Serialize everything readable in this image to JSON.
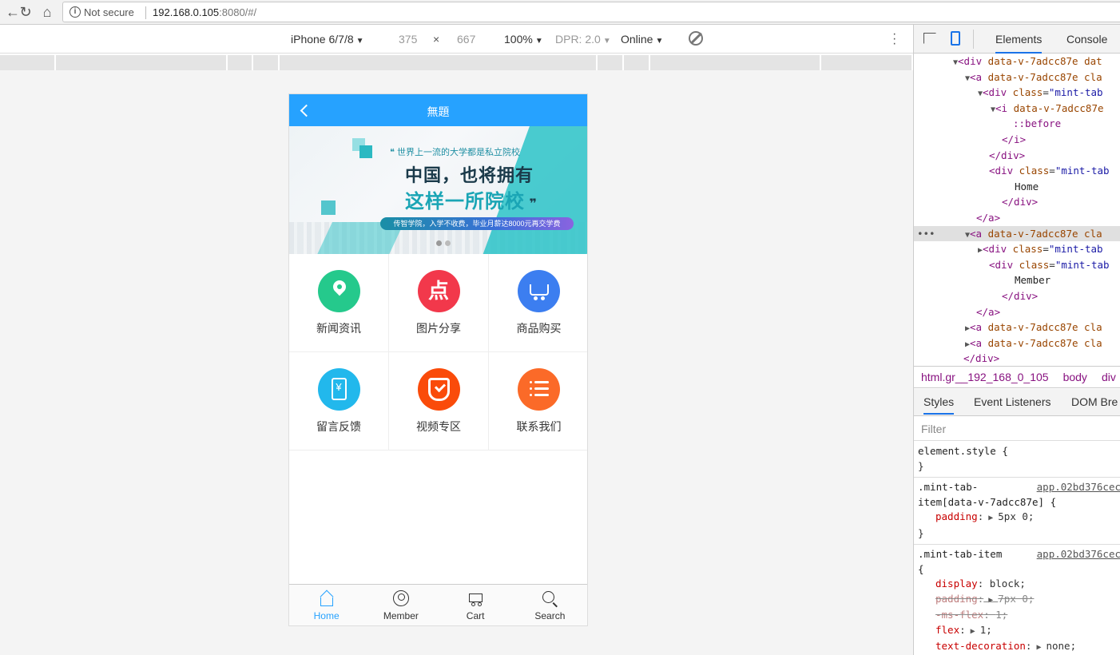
{
  "browser": {
    "security_label": "Not secure",
    "url_host": "192.168.0.105",
    "url_rest": ":8080/#/"
  },
  "device_toolbar": {
    "device": "iPhone 6/7/8",
    "width": "375",
    "times": "×",
    "height": "667",
    "zoom": "100%",
    "dpr": "DPR: 2.0",
    "network": "Online"
  },
  "app": {
    "header_title": "無題",
    "banner": {
      "quote": "❝ 世界上一流的大学都是私立院校",
      "line1": "中国，也将拥有",
      "line2_a": "这样一所院校",
      "line2_b": " ❞",
      "pill": "传智学院，入学不收费，毕业月薪达8000元再交学费"
    },
    "grid": [
      {
        "label": "新闻资讯",
        "icon": "location-pin-icon",
        "color": "#25c98c"
      },
      {
        "label": "图片分享",
        "icon": "dian-icon",
        "color": "#f2384b"
      },
      {
        "label": "商品购买",
        "icon": "shopping-cart-icon",
        "color": "#3c7ef0"
      },
      {
        "label": "留言反馈",
        "icon": "tablet-yen-icon",
        "color": "#22b8ec"
      },
      {
        "label": "视频专区",
        "icon": "shield-check-icon",
        "color": "#fa4b0a"
      },
      {
        "label": "联系我们",
        "icon": "list-icon",
        "color": "#fb6a28"
      }
    ],
    "tabs": [
      {
        "label": "Home",
        "icon": "home-icon",
        "active": true
      },
      {
        "label": "Member",
        "icon": "member-icon",
        "active": false
      },
      {
        "label": "Cart",
        "icon": "cart-icon",
        "active": false
      },
      {
        "label": "Search",
        "icon": "search-icon",
        "active": false
      }
    ],
    "accent": "#26a2ff"
  },
  "devtools": {
    "tabs": [
      "Elements",
      "Console"
    ],
    "breadcrumbs": [
      "html.gr__192_168_0_105",
      "body",
      "div"
    ],
    "subtabs": [
      "Styles",
      "Event Listeners",
      "DOM Bre"
    ],
    "filter_placeholder": "Filter",
    "element_style": "element.style {",
    "close_brace": "}",
    "rule1_selector_a": ".mint-tab-",
    "rule1_selector_b": "item[data-v-7adcc87e] {",
    "rule1_source": "app.02bd376cec",
    "rule1_prop": "padding",
    "rule1_val": "5px 0;",
    "rule2_selector": ".mint-tab-item",
    "rule2_open": "{",
    "rule2_source": "app.02bd376cec",
    "rule2_props": [
      {
        "name": "display",
        "value": "block;"
      },
      {
        "name": "padding",
        "value": "7px 0;"
      },
      {
        "name": "-ms-flex",
        "value": "1;"
      },
      {
        "name": "flex",
        "value": "1;"
      },
      {
        "name": "text-decoration",
        "value": "none;"
      }
    ]
  }
}
